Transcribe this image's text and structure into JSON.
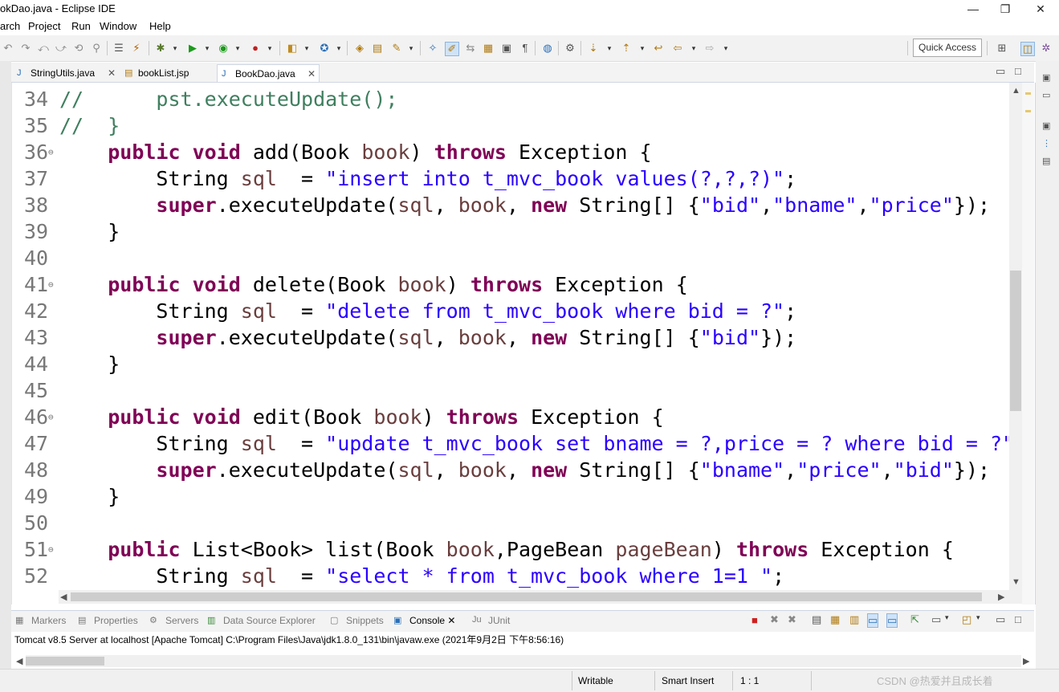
{
  "window": {
    "title": "okDao.java - Eclipse IDE",
    "minimize_glyph": "—",
    "maximize_glyph": "❐",
    "close_glyph": "✕"
  },
  "menu": [
    "arch",
    "Project",
    "Run",
    "Window",
    "Help"
  ],
  "toolbar": {
    "quick_access": "Quick Access"
  },
  "editor_tabs": [
    {
      "label": "StringUtils.java",
      "active": false,
      "close": "✕"
    },
    {
      "label": "bookList.jsp",
      "active": false,
      "close": ""
    },
    {
      "label": "BookDao.java",
      "active": true,
      "close": "✕"
    }
  ],
  "code": {
    "line_numbers": [
      "34",
      "35",
      "36",
      "37",
      "38",
      "39",
      "40",
      "41",
      "42",
      "43",
      "44",
      "45",
      "46",
      "47",
      "48",
      "49",
      "50",
      "51",
      "52"
    ],
    "fold_marker": "⊖"
  },
  "console": {
    "tabs": [
      {
        "label": "Markers",
        "icon": "markers-icon"
      },
      {
        "label": "Properties",
        "icon": "properties-icon"
      },
      {
        "label": "Servers",
        "icon": "servers-icon"
      },
      {
        "label": "Data Source Explorer",
        "icon": "datasource-icon"
      },
      {
        "label": "Snippets",
        "icon": "snippets-icon"
      },
      {
        "label": "Console",
        "icon": "console-icon",
        "close": "✕"
      },
      {
        "label": "JUnit",
        "icon": "junit-icon"
      }
    ],
    "description": "Tomcat v8.5 Server at localhost [Apache Tomcat] C:\\Program Files\\Java\\jdk1.8.0_131\\bin\\javaw.exe (2021年9月2日 下午8:56:16)"
  },
  "status": {
    "writable": "Writable",
    "insert_mode": "Smart Insert",
    "position": "1 : 1"
  },
  "watermark": "CSDN @热爱并且成长着",
  "colors": {
    "keyword": "#7f0055",
    "string": "#2a00ff",
    "variable": "#6a3e3e",
    "comment": "#3f7f5f"
  }
}
